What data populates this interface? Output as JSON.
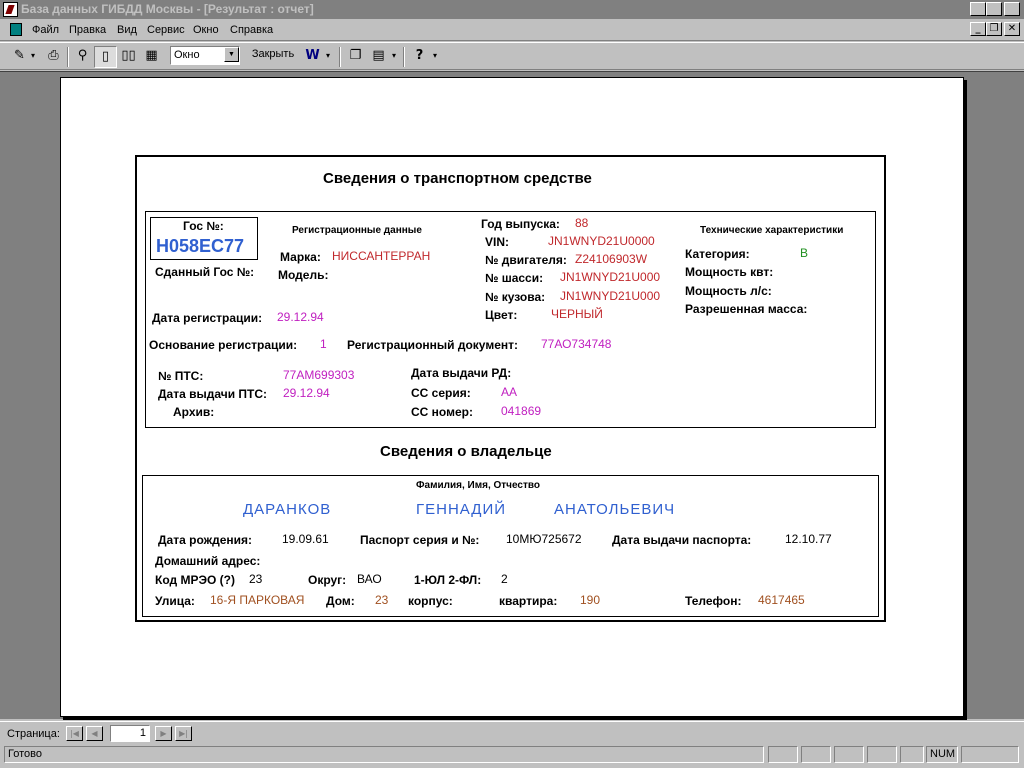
{
  "window": {
    "title": "База данных ГИБДД Москвы - [Результат : отчет]",
    "controls": {
      "minimize": "_",
      "restore": "❐",
      "close": "✕"
    }
  },
  "menu": [
    "Файл",
    "Правка",
    "Вид",
    "Сервис",
    "Окно",
    "Справка"
  ],
  "toolbar": {
    "zoom_value": "Окно",
    "close_label": "Закрыть"
  },
  "report": {
    "vehicle_title": "Сведения о транспортном средстве",
    "gos_label": "Гос №:",
    "gos_value": "Н058ЕС77",
    "surrendered_gos_label": "Сданный Гос №:",
    "reg_data_label": "Регистрационные данные",
    "brand_label": "Марка:",
    "brand_value": "НИССАНТЕРРАН",
    "model_label": "Модель:",
    "year_label": "Год выпуска:",
    "year_value": "88",
    "vin_label": "VIN:",
    "vin_value": "JN1WNYD21U0000",
    "engine_label": "№ двигателя:",
    "engine_value": "Z24106903W",
    "chassis_label": "№ шасси:",
    "chassis_value": "JN1WNYD21U000",
    "body_label": "№ кузова:",
    "body_value": "JN1WNYD21U000",
    "color_label": "Цвет:",
    "color_value": "ЧЕРНЫЙ",
    "tech_label": "Технические характеристики",
    "category_label": "Категория:",
    "category_value": "B",
    "power_kw_label": "Мощность квт:",
    "power_hp_label": "Мощность л/с:",
    "mass_label": "Разрешенная масса:",
    "reg_date_label": "Дата регистрации:",
    "reg_date_value": "29.12.94",
    "reg_basis_label": "Основание регистрации:",
    "reg_basis_value": "1",
    "reg_doc_label": "Регистрационный документ:",
    "reg_doc_value": "77АО734748",
    "pts_label": "№ ПТС:",
    "pts_value": "77АМ699303",
    "pts_date_label": "Дата выдачи ПТС:",
    "pts_date_value": "29.12.94",
    "archive_label": "Архив:",
    "rd_date_label": "Дата выдачи РД:",
    "cc_series_label": "СС серия:",
    "cc_series_value": "АА",
    "cc_number_label": "СС номер:",
    "cc_number_value": "041869",
    "owner_title": "Сведения о владельце",
    "fio_label": "Фамилия, Имя, Отчество",
    "last_name": "ДАРАНКОВ",
    "first_name": "ГЕННАДИЙ",
    "patronymic": "АНАТОЛЬЕВИЧ",
    "birth_label": "Дата рождения:",
    "birth_value": "19.09.61",
    "passport_label": "Паспорт серия и №:",
    "passport_value": "10МЮ725672",
    "passport_date_label": "Дата выдачи паспорта:",
    "passport_date_value": "12.10.77",
    "home_address_label": "Домашний адрес:",
    "mreo_label": "Код МРЭО (?)",
    "mreo_value": "23",
    "okrug_label": "Округ:",
    "okrug_value": "ВАО",
    "ul_fl_label": "1-ЮЛ 2-ФЛ:",
    "ul_fl_value": "2",
    "street_label": "Улица:",
    "street_value": "16-Я ПАРКОВАЯ",
    "house_label": "Дом:",
    "house_value": "23",
    "korpus_label": "корпус:",
    "apt_label": "квартира:",
    "apt_value": "190",
    "phone_label": "Телефон:",
    "phone_value": "4617465"
  },
  "navigation": {
    "page_label": "Страница:",
    "page_value": "1"
  },
  "status": {
    "text": "Готово",
    "num": "NUM"
  },
  "colors": {
    "workspace": "#808080",
    "red_value": "#c0282c",
    "magenta_value": "#c020c0",
    "blue_value": "#3060d0",
    "brown_value": "#a05020",
    "green_value": "#209020"
  }
}
